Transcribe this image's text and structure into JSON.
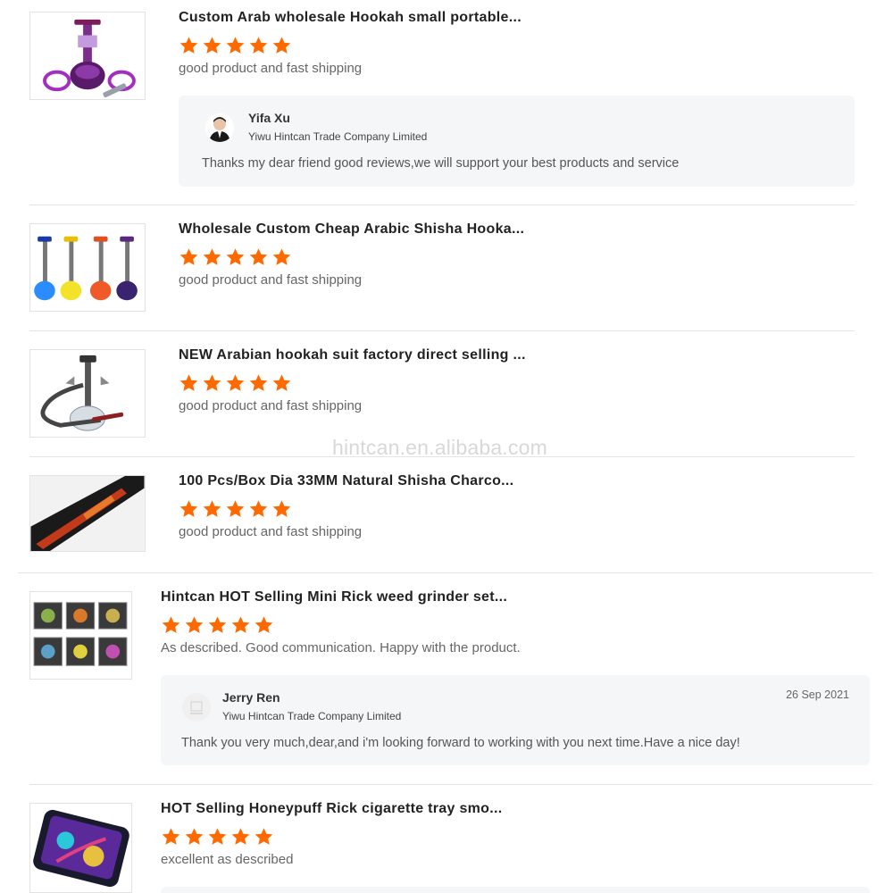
{
  "watermark": "hintcan.en.alibaba.com",
  "reviews": [
    {
      "title": "Custom Arab wholesale Hookah small portable...",
      "rating": 5,
      "comment": "good product and fast shipping",
      "image_icon": "purple-hookah-product-image",
      "reply": {
        "name": "Yifa Xu",
        "company": "Yiwu Hintcan Trade Company Limited",
        "message": "Thanks my dear friend good reviews,we will support your best products and service",
        "date": ""
      }
    },
    {
      "title": "Wholesale Custom Cheap Arabic Shisha Hooka...",
      "rating": 5,
      "comment": "good product and fast shipping",
      "image_icon": "colorful-hookahs-product-image"
    },
    {
      "title": "NEW Arabian hookah suit factory direct selling ...",
      "rating": 5,
      "comment": "good product and fast shipping",
      "image_icon": "clear-hookah-product-image"
    },
    {
      "title": "100 Pcs/Box Dia 33MM Natural Shisha Charco...",
      "rating": 5,
      "comment": "good product and fast shipping",
      "image_icon": "charcoal-box-product-image"
    },
    {
      "title": "Hintcan HOT Selling Mini Rick weed grinder set...",
      "rating": 5,
      "comment": "As described. Good communication. Happy with the product.",
      "image_icon": "grinder-set-product-image",
      "reply": {
        "name": "Jerry Ren",
        "company": "Yiwu Hintcan Trade Company Limited",
        "message": "Thank you very much,dear,and i'm looking forward to working with you next time.Have a nice day!",
        "date": "26 Sep 2021"
      }
    },
    {
      "title": "HOT Selling Honeypuff Rick cigarette tray smo...",
      "rating": 5,
      "comment": "excellent as described",
      "image_icon": "rolling-tray-product-image"
    }
  ],
  "colors": {
    "star": "#ff6a00",
    "reply_bg": "#f5f6f7",
    "divider": "#e4e4e4"
  }
}
